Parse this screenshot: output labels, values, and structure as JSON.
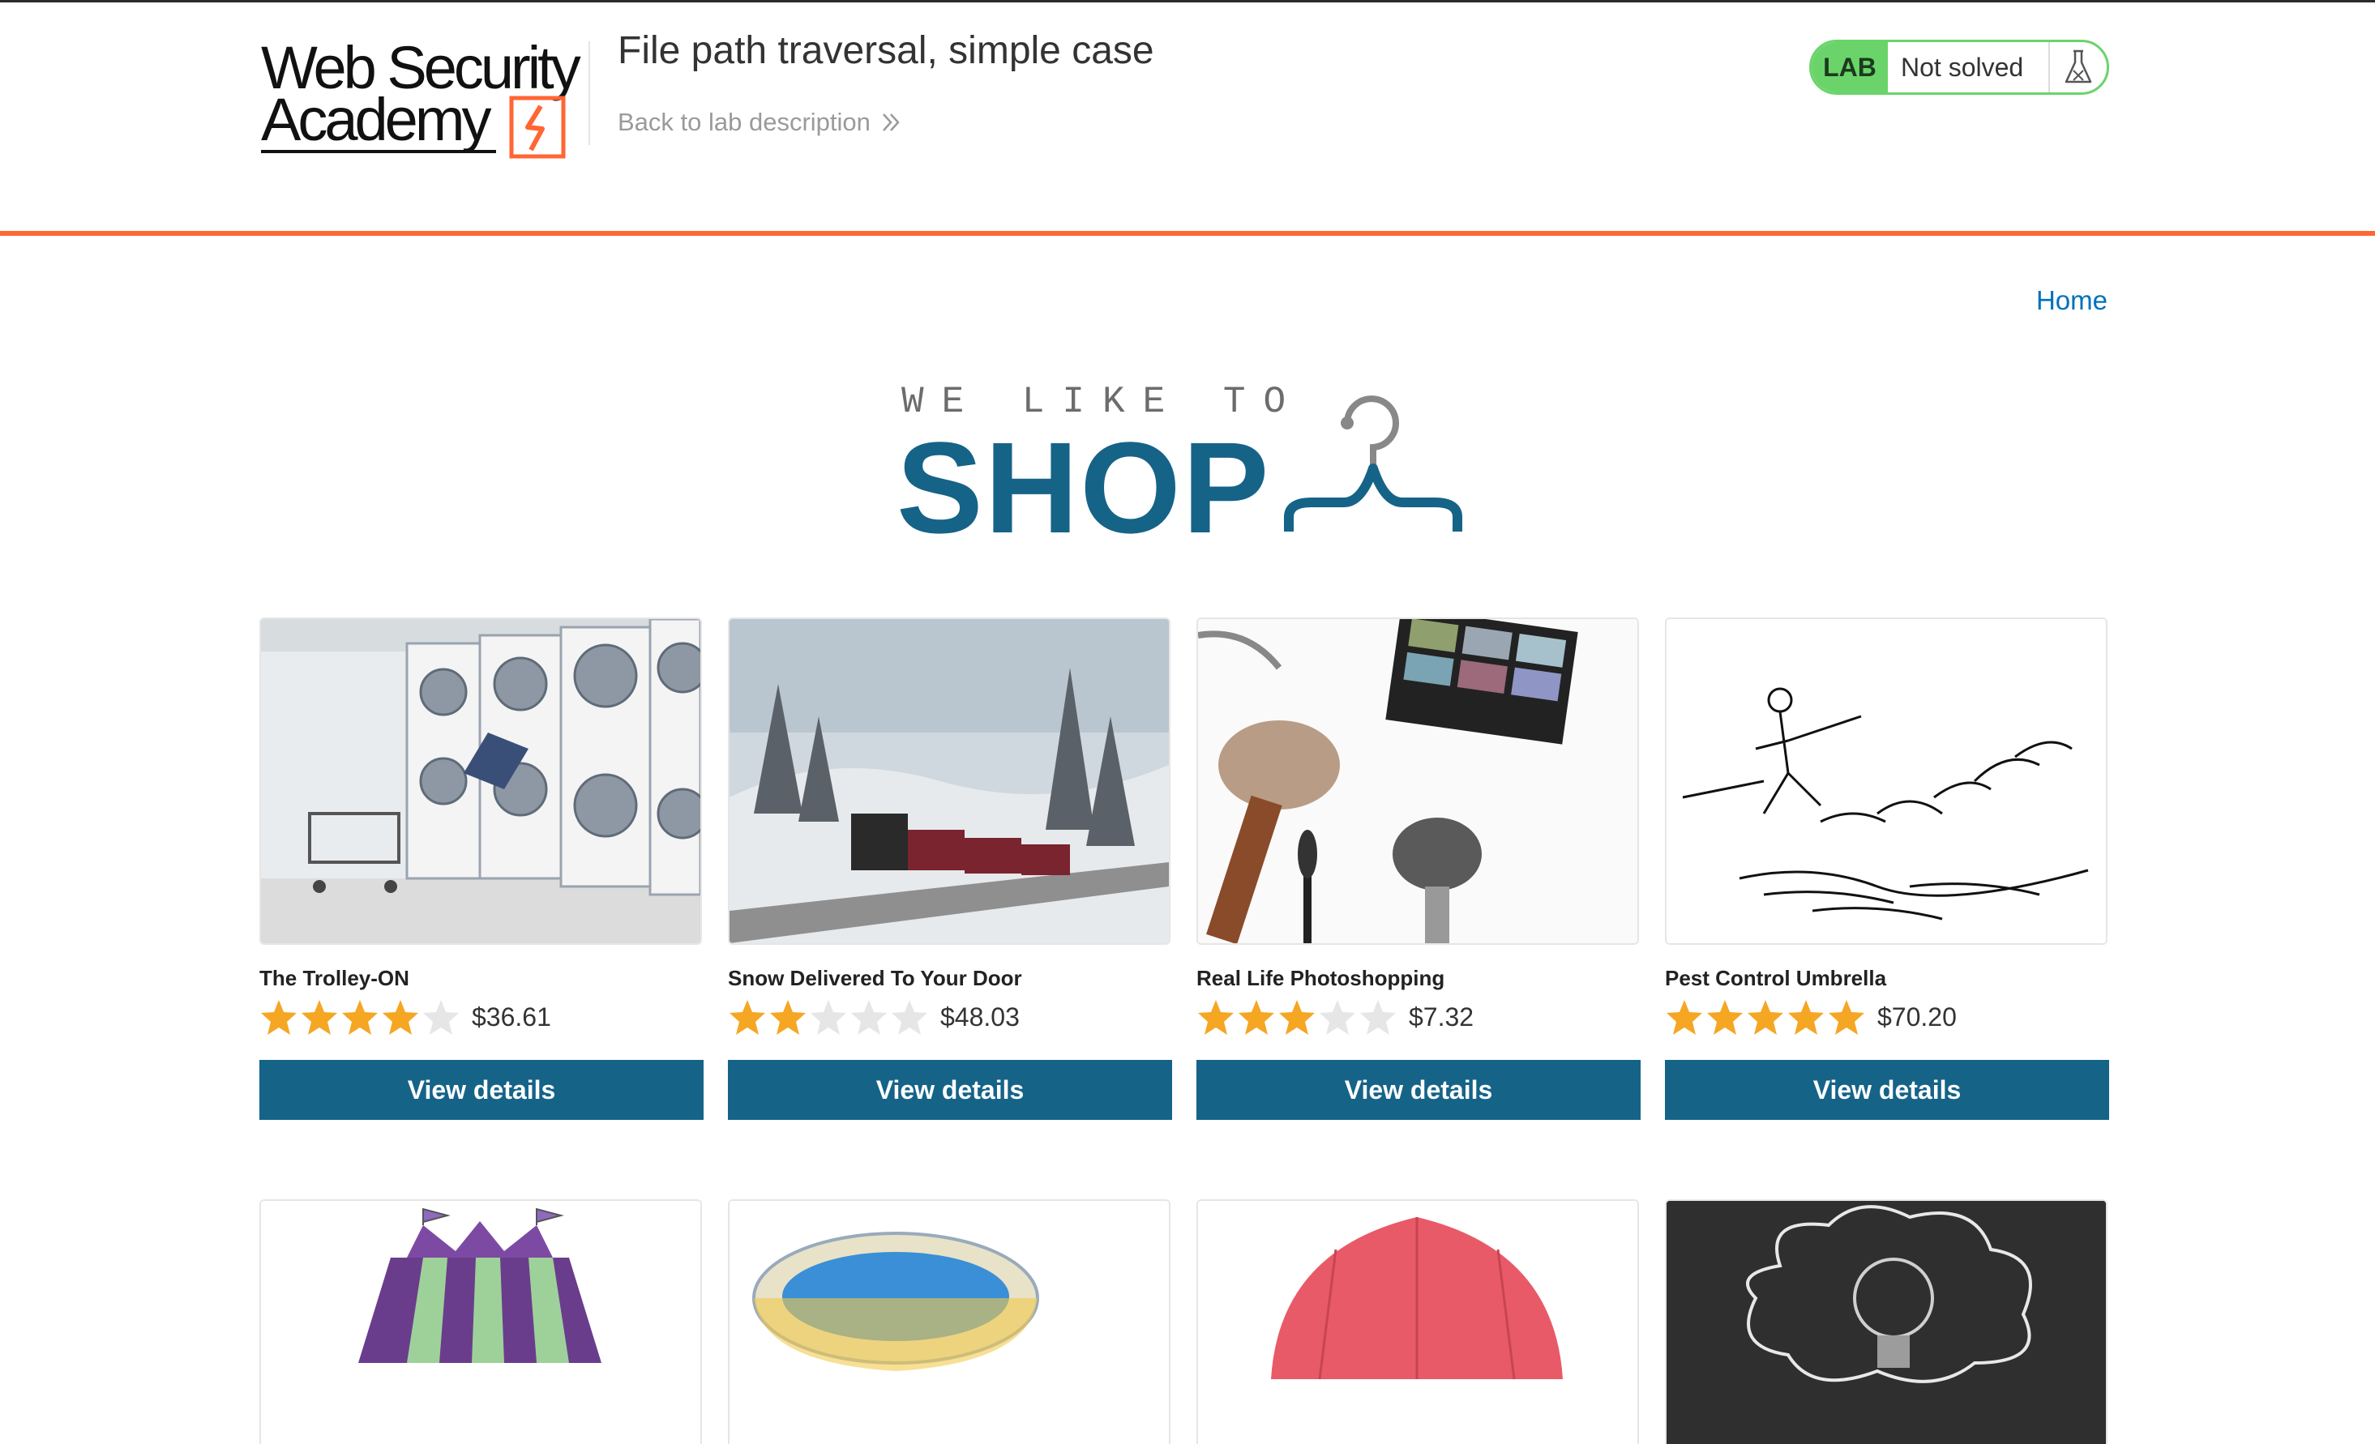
{
  "header": {
    "logo_line1": "Web Security",
    "logo_line2": "Academy",
    "lab_title": "File path traversal, simple case",
    "back_link": "Back to lab description",
    "status_badge": "LAB",
    "status_text": "Not solved"
  },
  "nav": {
    "home": "Home"
  },
  "banner": {
    "small": "WE LIKE TO",
    "big": "SHOP"
  },
  "colors": {
    "accent": "#166388",
    "orange": "#ff6633",
    "status_green": "#6ad46b",
    "star": "#f5a623",
    "star_empty": "#e6e6e6"
  },
  "products": [
    {
      "name": "The Trolley-ON",
      "rating": 4,
      "price": "$36.61",
      "button": "View details",
      "image": "laundromat-photo"
    },
    {
      "name": "Snow Delivered To Your Door",
      "rating": 2,
      "price": "$48.03",
      "button": "View details",
      "image": "snow-train-photo"
    },
    {
      "name": "Real Life Photoshopping",
      "rating": 3,
      "price": "$7.32",
      "button": "View details",
      "image": "makeup-brushes-photo"
    },
    {
      "name": "Pest Control Umbrella",
      "rating": 5,
      "price": "$70.20",
      "button": "View details",
      "image": "umbrella-sketch"
    }
  ],
  "products_row2": [
    {
      "image": "circus-tent"
    },
    {
      "image": "paddling-pool"
    },
    {
      "image": "red-umbrella"
    },
    {
      "image": "lightbulb-chalkboard"
    }
  ]
}
